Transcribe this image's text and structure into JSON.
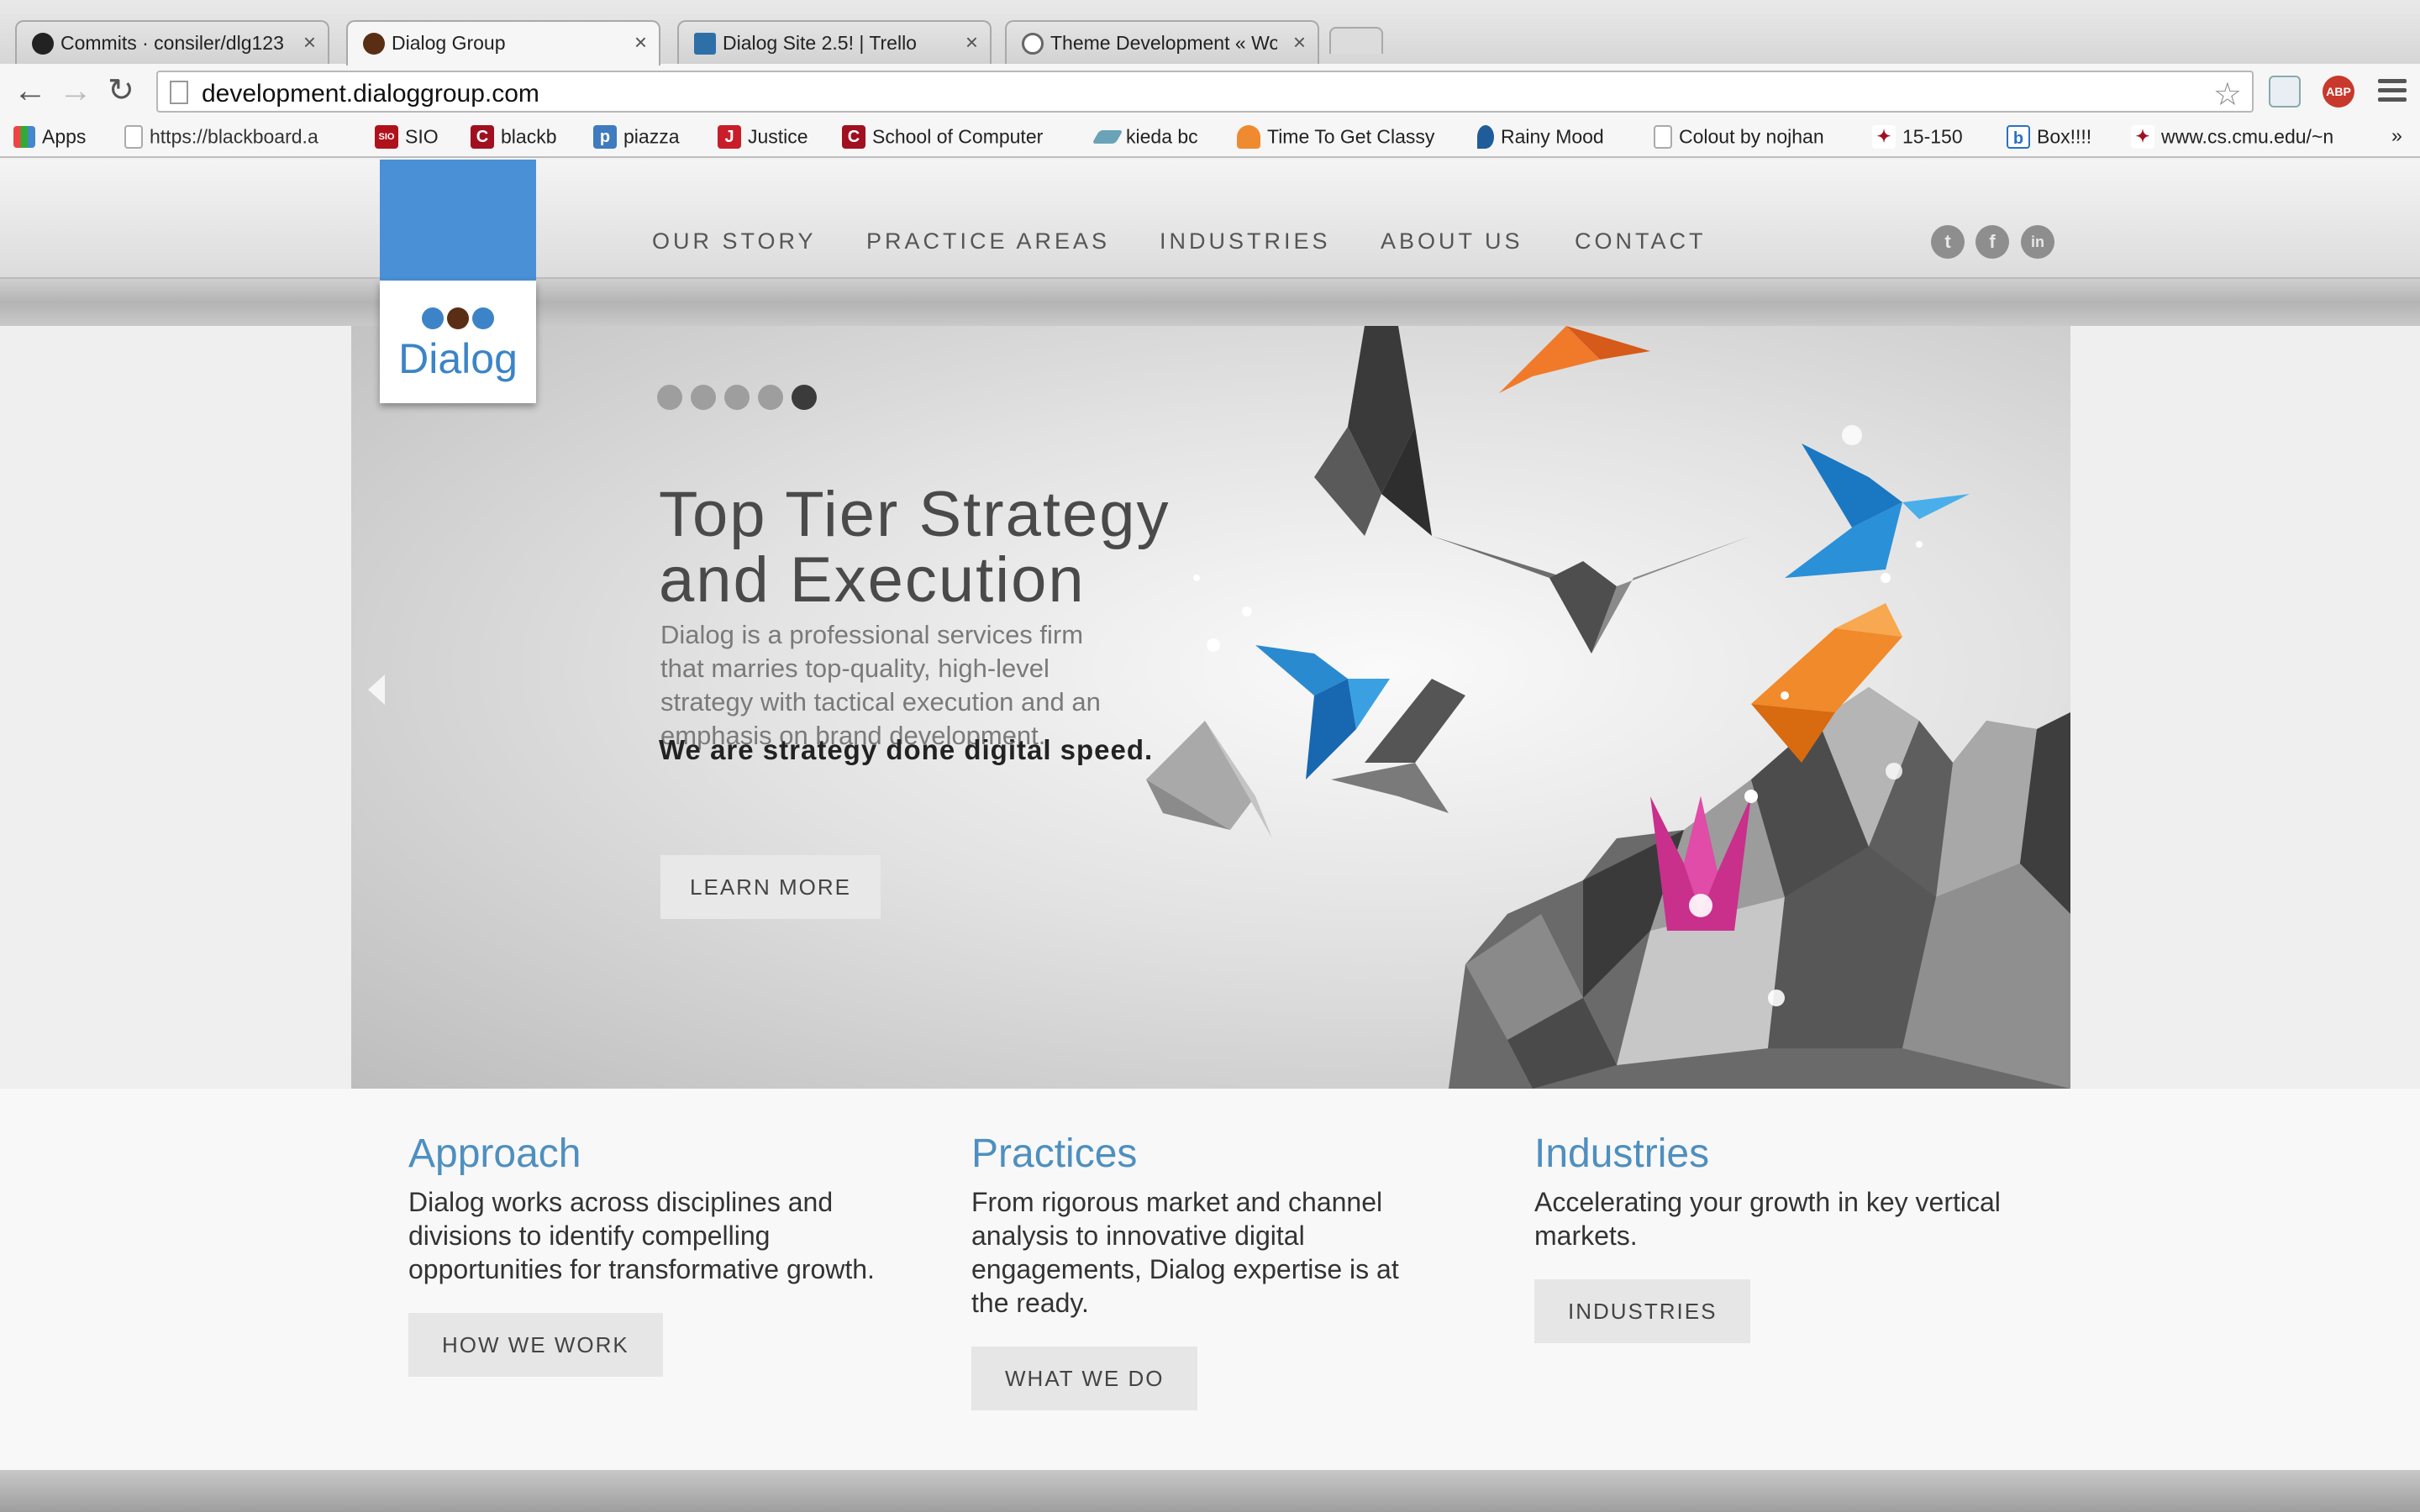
{
  "browser": {
    "tabs": [
      {
        "title": "Commits · consiler/dlg123",
        "favicon": "github-icon"
      },
      {
        "title": "Dialog Group",
        "favicon": "dialog-favicon"
      },
      {
        "title": "Dialog Site 2.5! | Trello",
        "favicon": "trello-icon"
      },
      {
        "title": "Theme Development « Wor",
        "favicon": "wordpress-icon"
      }
    ],
    "url": "development.dialoggroup.com",
    "bookmarks": [
      {
        "label": "Apps"
      },
      {
        "label": "https://blackboard.a"
      },
      {
        "label": "SIO",
        "icon_text": "SIO"
      },
      {
        "label": "blackb",
        "icon_text": "C"
      },
      {
        "label": "piazza",
        "icon_text": "p"
      },
      {
        "label": "Justice",
        "icon_text": "J"
      },
      {
        "label": "School of Computer",
        "icon_text": "C"
      },
      {
        "label": "kieda bc"
      },
      {
        "label": "Time To Get Classy"
      },
      {
        "label": "Rainy Mood"
      },
      {
        "label": "Colout by nojhan"
      },
      {
        "label": "15-150"
      },
      {
        "label": "Box!!!!",
        "icon_text": "b"
      },
      {
        "label": "www.cs.cmu.edu/~n"
      }
    ],
    "overflow": "»",
    "abp_label": "ABP"
  },
  "site": {
    "logo": {
      "word": "Dialog",
      "colors": [
        "#3c84c7",
        "#5a2e14",
        "#3c84c7"
      ]
    },
    "nav": [
      "OUR STORY",
      "PRACTICE AREAS",
      "INDUSTRIES",
      "ABOUT US",
      "CONTACT"
    ],
    "social": [
      {
        "name": "twitter-icon",
        "glyph": "t"
      },
      {
        "name": "facebook-icon",
        "glyph": "f"
      },
      {
        "name": "linkedin-icon",
        "glyph": "in"
      }
    ],
    "hero": {
      "slides": 5,
      "active_slide": 5,
      "title": "Top Tier Strategy and Execution",
      "body": "Dialog is a professional services firm that marries top-quality, high-level strategy with tactical execution and an emphasis on brand development.",
      "tagline": "We are strategy done digital speed.",
      "button": "LEARN MORE"
    },
    "features": [
      {
        "heading": "Approach",
        "text": "Dialog works across disciplines and divisions to identify compelling opportunities for transformative growth.",
        "button": "HOW WE WORK"
      },
      {
        "heading": "Practices",
        "text": "From rigorous market and channel analysis to innovative digital engagements, Dialog expertise is at the ready.",
        "button": "WHAT WE DO"
      },
      {
        "heading": "Industries",
        "text": "Accelerating your growth in key vertical markets.",
        "button": "INDUSTRIES"
      }
    ],
    "accent": "#4a90d6"
  }
}
